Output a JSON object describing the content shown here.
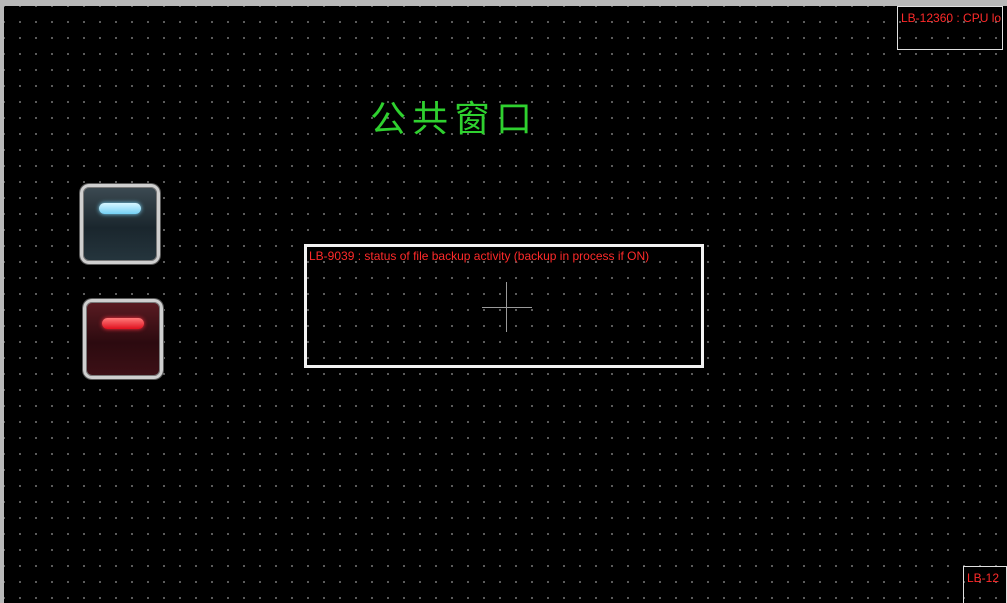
{
  "window": {
    "title": "公共窗口"
  },
  "tags": {
    "cpu_tag": "LB-12360 : CPU lo",
    "corner_tag": "LB-12",
    "backup_status": "LB-9039 : status of file backup activity (backup in process if ON)"
  },
  "colors": {
    "background": "#000000",
    "title": "#2fd12f",
    "tag_text": "#ff2a2a",
    "blue_led": "#74d0f5",
    "red_led": "#e0101e"
  },
  "buttons": [
    {
      "color": "blue",
      "icon": "blue-led-icon"
    },
    {
      "color": "red",
      "icon": "red-led-icon"
    }
  ]
}
